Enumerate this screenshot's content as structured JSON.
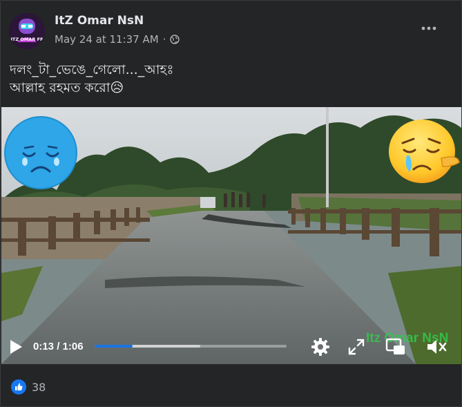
{
  "post": {
    "author": "ItZ Omar NsN",
    "avatar_text": "ITZ OMAR FF",
    "timestamp": "May 24 at 11:37 AM",
    "separator": "·",
    "audience_icon": "globe-icon",
    "more_icon": "more-dots-icon",
    "text": "দলং_টা_ভেঙে_গেলো..._আহঃ\nআল্লাহ রহমত করো😥"
  },
  "video": {
    "current_time": "0:13",
    "separator": "/",
    "duration": "1:06",
    "progress_fraction": 0.197,
    "buffer_fraction": 0.55,
    "watermark": "Itz Omar NsN",
    "icons": [
      "play-icon",
      "settings-icon",
      "fullscreen-icon",
      "pip-icon",
      "muted-speaker-icon"
    ]
  },
  "reactions": {
    "like_icon": "like-thumb-icon",
    "count": "38"
  },
  "colors": {
    "background": "#242526",
    "text": "#e4e6eb",
    "secondary_text": "#b0b3b8",
    "accent": "#1b74e4",
    "watermark": "#33c94b"
  }
}
